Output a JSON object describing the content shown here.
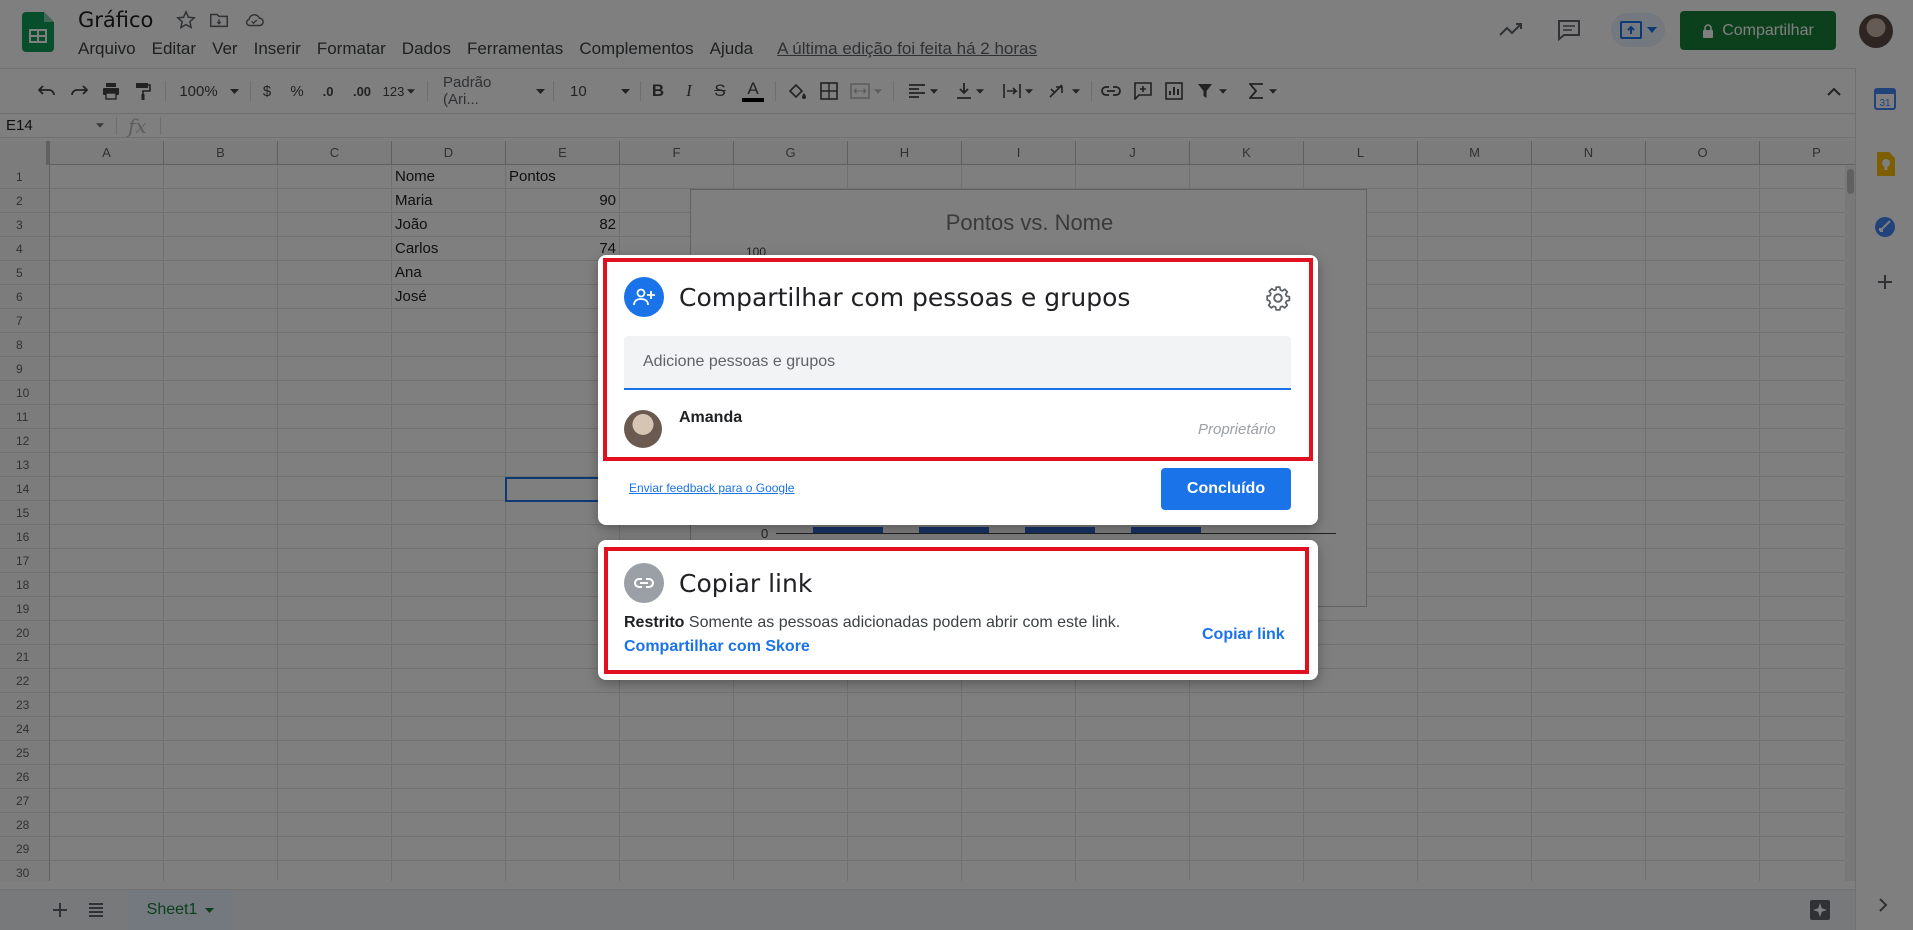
{
  "app": {
    "doc_title": "Gráfico",
    "menu": [
      "Arquivo",
      "Editar",
      "Ver",
      "Inserir",
      "Formatar",
      "Dados",
      "Ferramentas",
      "Complementos",
      "Ajuda"
    ],
    "last_edit": "A última edição foi feita há 2 horas",
    "share_button": "Compartilhar",
    "brand_color": "#188038"
  },
  "toolbar": {
    "zoom": "100%",
    "currency": "$",
    "percent": "%",
    "dec_less": ".0",
    "dec_more": ".00",
    "format_more": "123",
    "font": "Padrão (Ari...",
    "font_size": "10",
    "bold": "B",
    "italic": "I",
    "strike": "S",
    "text_color": "A"
  },
  "formula_bar": {
    "cell_ref": "E14",
    "fx": "fx"
  },
  "grid": {
    "columns": [
      "A",
      "B",
      "C",
      "D",
      "E",
      "F",
      "G",
      "H",
      "I",
      "J",
      "K",
      "L",
      "M",
      "N",
      "O",
      "P"
    ],
    "rows": [
      "1",
      "2",
      "3",
      "4",
      "5",
      "6",
      "7",
      "8",
      "9",
      "10",
      "11",
      "12",
      "13",
      "14",
      "15",
      "16",
      "17",
      "18",
      "19",
      "20",
      "21",
      "22",
      "23",
      "24",
      "25",
      "26",
      "27",
      "28",
      "29",
      "30"
    ],
    "header_name": "Nome",
    "header_points": "Pontos",
    "names": [
      "Maria",
      "João",
      "Carlos",
      "Ana",
      "José"
    ],
    "points": [
      "90",
      "82",
      "74"
    ]
  },
  "chart": {
    "title": "Pontos vs. Nome",
    "y_top": "100",
    "y_zero": "0"
  },
  "sheet": {
    "tab_name": "Sheet1"
  },
  "share_dialog": {
    "title": "Compartilhar com pessoas e grupos",
    "input_placeholder": "Adicione pessoas e grupos",
    "user_name": "Amanda",
    "user_role": "Proprietário",
    "feedback_link": "Enviar feedback para o Google",
    "done_button": "Concluído"
  },
  "copy_dialog": {
    "title": "Copiar link",
    "restricted_label": "Restrito",
    "restricted_desc": "Somente as pessoas adicionadas podem abrir com este link.",
    "share_with": "Compartilhar com Skore",
    "copy_button": "Copiar link"
  }
}
